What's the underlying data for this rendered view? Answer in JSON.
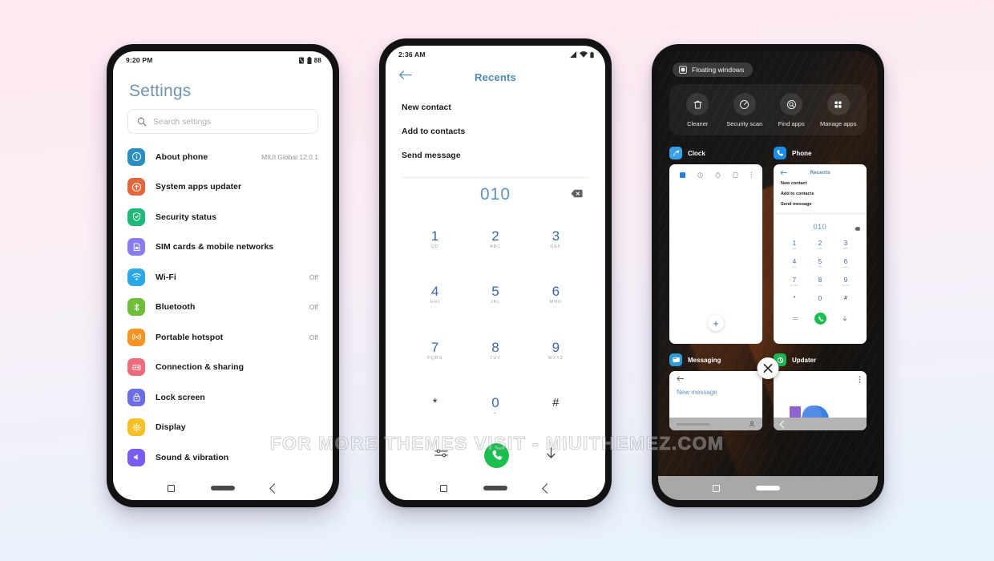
{
  "watermark": "FOR MORE THEMES VISIT - MIUITHEMEZ.COM",
  "background": {
    "top_color": "#fdeaf3",
    "bottom_color": "#e6f3fb"
  },
  "phone1": {
    "status": {
      "time": "9:20 PM",
      "battery_level": "88"
    },
    "title": "Settings",
    "search": {
      "placeholder": "Search settings",
      "icon": "search-icon"
    },
    "items": [
      {
        "label": "About phone",
        "value": "MIUI Global 12.0.1",
        "icon": "info-icon",
        "color": "#2a8fc0"
      },
      {
        "label": "System apps updater",
        "value": "",
        "icon": "arrow-up-circle-icon",
        "color": "#e2663a"
      },
      {
        "label": "Security status",
        "value": "",
        "icon": "shield-check-icon",
        "color": "#1db87a"
      },
      {
        "label": "SIM cards & mobile networks",
        "value": "",
        "icon": "sim-card-icon",
        "color": "#8b7bf0"
      },
      {
        "label": "Wi-Fi",
        "value": "Off",
        "icon": "wifi-icon",
        "color": "#2aa7e8"
      },
      {
        "label": "Bluetooth",
        "value": "Off",
        "icon": "bluetooth-icon",
        "color": "#6fbf3a"
      },
      {
        "label": "Portable hotspot",
        "value": "Off",
        "icon": "hotspot-icon",
        "color": "#f59324"
      },
      {
        "label": "Connection & sharing",
        "value": "",
        "icon": "connection-share-icon",
        "color": "#ef6a7d"
      },
      {
        "label": "Lock screen",
        "value": "",
        "icon": "lock-icon",
        "color": "#6c6ce8"
      },
      {
        "label": "Display",
        "value": "",
        "icon": "brightness-icon",
        "color": "#f5c026"
      },
      {
        "label": "Sound & vibration",
        "value": "",
        "icon": "sound-icon",
        "color": "#7a5cf0"
      }
    ],
    "navbar": {
      "recents": "recents-square-icon",
      "home": "home-pill-icon",
      "back": "back-chevron-icon"
    }
  },
  "phone2": {
    "status": {
      "time": "2:36 AM"
    },
    "header": {
      "back": "back-arrow-icon",
      "title": "Recents"
    },
    "options": [
      "New contact",
      "Add to contacts",
      "Send message"
    ],
    "dialed_number": "010",
    "backspace": "backspace-icon",
    "keypad": [
      {
        "digit": "1",
        "letters": "QD"
      },
      {
        "digit": "2",
        "letters": "ABC"
      },
      {
        "digit": "3",
        "letters": "DEF"
      },
      {
        "digit": "4",
        "letters": "GHI"
      },
      {
        "digit": "5",
        "letters": "JKL"
      },
      {
        "digit": "6",
        "letters": "MNO"
      },
      {
        "digit": "7",
        "letters": "PQRS"
      },
      {
        "digit": "8",
        "letters": "TUV"
      },
      {
        "digit": "9",
        "letters": "WXYZ"
      },
      {
        "digit": "*",
        "letters": ""
      },
      {
        "digit": "0",
        "letters": "+"
      },
      {
        "digit": "#",
        "letters": ""
      }
    ],
    "bottom": {
      "settings": "dialpad-settings-icon",
      "call": "call-icon",
      "hide": "hide-dialpad-icon"
    },
    "call_button_color": "#1bbf4f"
  },
  "phone3": {
    "floating_windows": {
      "label": "Floating windows",
      "icon": "floating-window-icon"
    },
    "tools": [
      {
        "label": "Cleaner",
        "icon": "trash-icon"
      },
      {
        "label": "Security scan",
        "icon": "scan-shield-icon"
      },
      {
        "label": "Find apps",
        "icon": "find-apps-icon"
      },
      {
        "label": "Manage apps",
        "icon": "grid-apps-icon"
      }
    ],
    "cards": [
      {
        "app": "Clock",
        "icon": "clock-icon",
        "color": "#3aa0e8"
      },
      {
        "app": "Phone",
        "icon": "phone-icon",
        "color": "#1a8de8"
      }
    ],
    "cards_row2": [
      {
        "app": "Messaging",
        "icon": "messaging-icon",
        "color": "#2e9bd8"
      },
      {
        "app": "Updater",
        "icon": "updater-icon",
        "color": "#22b352"
      }
    ],
    "clock_preview": {
      "tabs": [
        "alarm-icon",
        "clock-icon",
        "timer-icon",
        "stopwatch-icon",
        "menu-icon"
      ],
      "fab": "+"
    },
    "phone_preview": {
      "title": "Recents",
      "options": [
        "New contact",
        "Add to contacts",
        "Send message"
      ],
      "dialed_number": "010",
      "keypad": [
        {
          "digit": "1",
          "letters": "QD"
        },
        {
          "digit": "2",
          "letters": "ABC"
        },
        {
          "digit": "3",
          "letters": "DEF"
        },
        {
          "digit": "4",
          "letters": "GHI"
        },
        {
          "digit": "5",
          "letters": "JKL"
        },
        {
          "digit": "6",
          "letters": "MNO"
        },
        {
          "digit": "7",
          "letters": "PQRS"
        },
        {
          "digit": "8",
          "letters": "TUV"
        },
        {
          "digit": "9",
          "letters": "WXYZ"
        },
        {
          "digit": "*",
          "letters": ""
        },
        {
          "digit": "0",
          "letters": "+"
        },
        {
          "digit": "#",
          "letters": ""
        }
      ]
    },
    "messaging_preview": {
      "title": "New message",
      "back": "back-arrow-icon",
      "contact": "contact-icon"
    },
    "close_button": "close-icon"
  }
}
